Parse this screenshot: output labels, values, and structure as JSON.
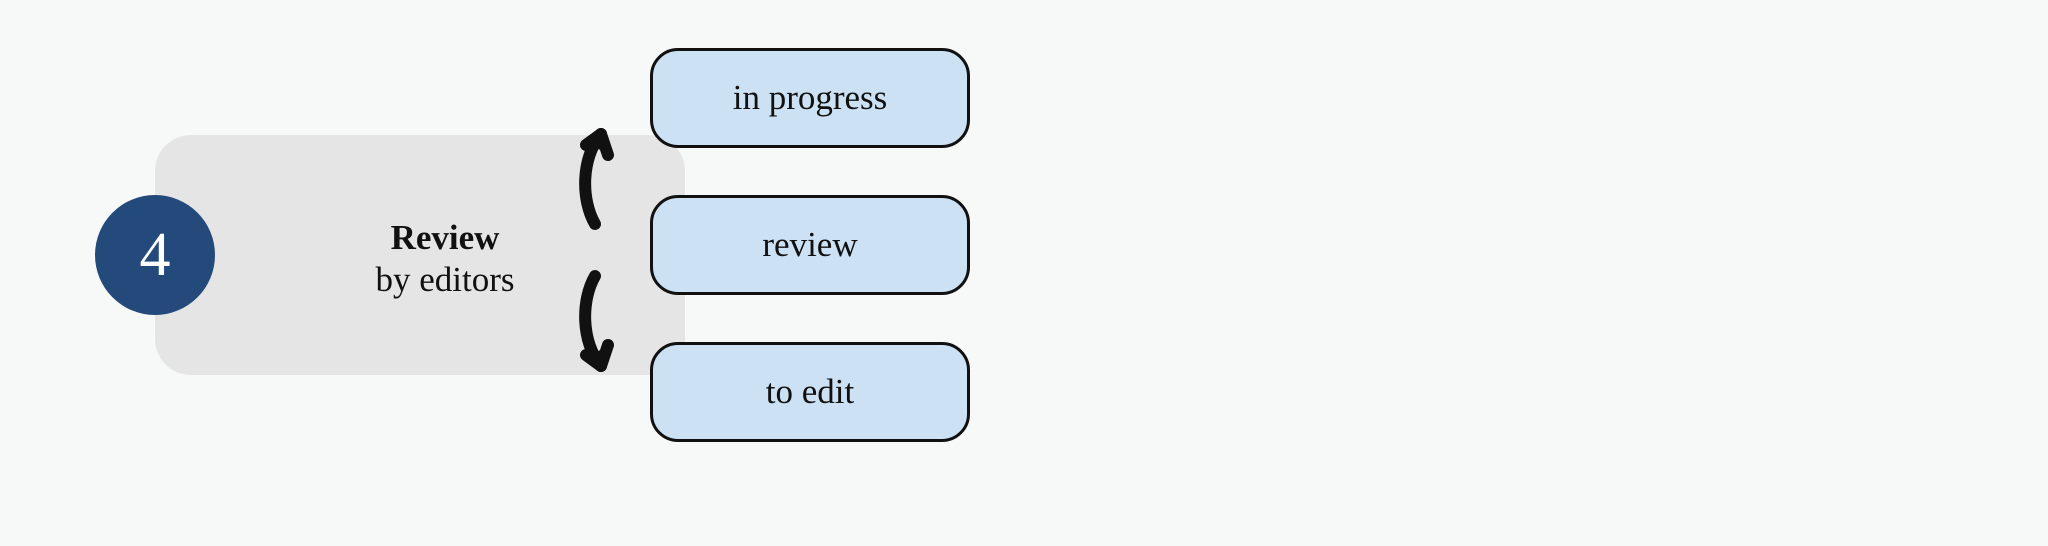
{
  "step": {
    "number": "4",
    "title": "Review",
    "subtitle": "by editors"
  },
  "states": {
    "s1": "in progress",
    "s2": "review",
    "s3": "to edit"
  },
  "colors": {
    "circle": "#234a7a",
    "pill": "#cde1f4",
    "card": "#e5e5e5"
  }
}
